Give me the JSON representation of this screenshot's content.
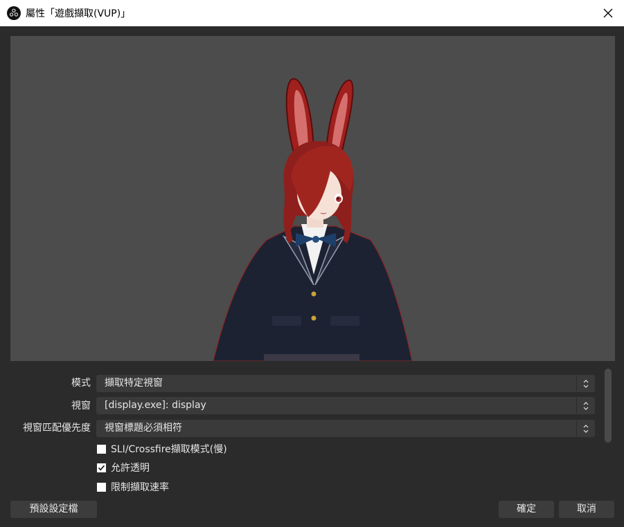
{
  "window": {
    "title": "屬性「遊戲擷取(VUP)」",
    "app_icon": "obs-icon",
    "close_icon": "close-icon"
  },
  "preview": {
    "description_icon": "avatar-preview"
  },
  "form": {
    "mode": {
      "label": "模式",
      "value": "擷取特定視窗"
    },
    "window": {
      "label": "視窗",
      "value": "[display.exe]: display"
    },
    "priority": {
      "label": "視窗匹配優先度",
      "value": "視窗標題必須相符"
    },
    "checks": [
      {
        "label": "SLI/Crossfire擷取模式(慢)",
        "checked": false
      },
      {
        "label": "允許透明",
        "checked": true
      },
      {
        "label": "限制擷取速率",
        "checked": false
      }
    ]
  },
  "footer": {
    "defaults_label": "預設設定檔",
    "ok_label": "確定",
    "cancel_label": "取消"
  },
  "colors": {
    "background": "#2b2b2b",
    "preview_bg": "#4c4c4c",
    "control_bg": "#3a3a3a",
    "text": "#e6e6e6"
  }
}
